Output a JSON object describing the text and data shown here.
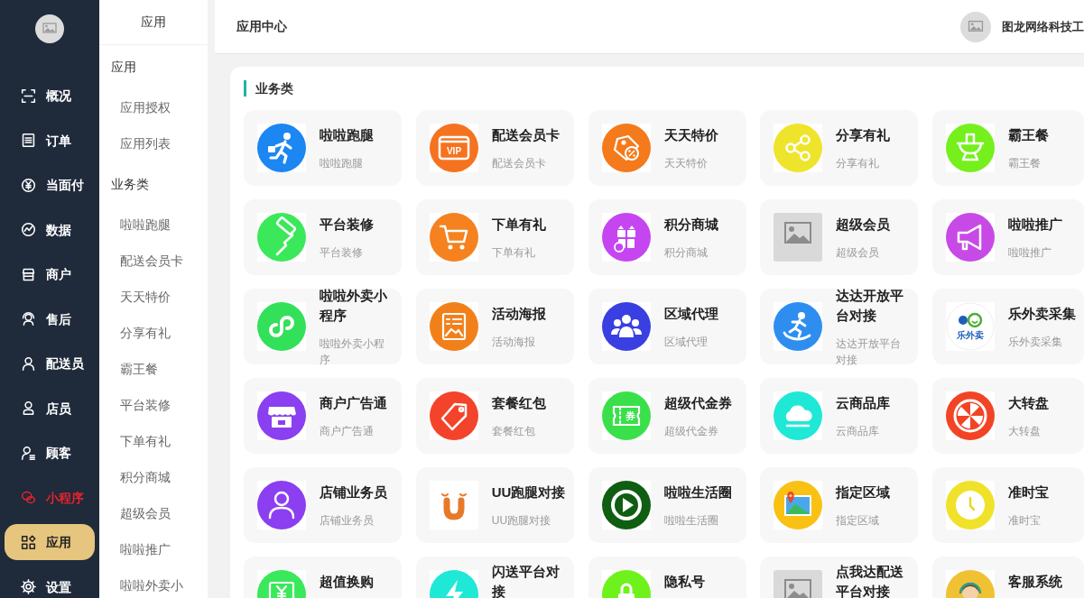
{
  "sidebar": {
    "items": [
      {
        "label": "概况",
        "selected": false,
        "highlighted": false
      },
      {
        "label": "订单",
        "selected": false,
        "highlighted": false
      },
      {
        "label": "当面付",
        "selected": false,
        "highlighted": false
      },
      {
        "label": "数据",
        "selected": false,
        "highlighted": false
      },
      {
        "label": "商户",
        "selected": false,
        "highlighted": false
      },
      {
        "label": "售后",
        "selected": false,
        "highlighted": false
      },
      {
        "label": "配送员",
        "selected": false,
        "highlighted": false
      },
      {
        "label": "店员",
        "selected": false,
        "highlighted": false
      },
      {
        "label": "顾客",
        "selected": false,
        "highlighted": false
      },
      {
        "label": "小程序",
        "selected": false,
        "highlighted": true
      },
      {
        "label": "应用",
        "selected": true,
        "highlighted": false
      },
      {
        "label": "设置",
        "selected": false,
        "highlighted": false
      }
    ]
  },
  "submenu": {
    "title": "应用",
    "groups": [
      {
        "heading": "应用",
        "items": [
          {
            "label": "应用授权",
            "selected": false
          },
          {
            "label": "应用列表",
            "selected": false
          }
        ]
      },
      {
        "heading": "业务类",
        "items": [
          {
            "label": "啦啦跑腿",
            "selected": false
          },
          {
            "label": "配送会员卡",
            "selected": false
          },
          {
            "label": "天天特价",
            "selected": false
          },
          {
            "label": "分享有礼",
            "selected": false
          },
          {
            "label": "霸王餐",
            "selected": false
          },
          {
            "label": "平台装修",
            "selected": false
          },
          {
            "label": "下单有礼",
            "selected": false
          },
          {
            "label": "积分商城",
            "selected": false
          },
          {
            "label": "超级会员",
            "selected": false
          },
          {
            "label": "啦啦推广",
            "selected": false
          },
          {
            "label": "啦啦外卖小",
            "selected": false
          }
        ]
      }
    ]
  },
  "header": {
    "title": "应用中心",
    "user": "图龙网络科技工"
  },
  "section": {
    "heading": "业务类",
    "apps": [
      {
        "title": "啦啦跑腿",
        "subtitle": "啦啦跑腿"
      },
      {
        "title": "配送会员卡",
        "subtitle": "配送会员卡",
        "icon_text": "VIP"
      },
      {
        "title": "天天特价",
        "subtitle": "天天特价"
      },
      {
        "title": "分享有礼",
        "subtitle": "分享有礼"
      },
      {
        "title": "霸王餐",
        "subtitle": "霸王餐"
      },
      {
        "title": "平台装修",
        "subtitle": "平台装修"
      },
      {
        "title": "下单有礼",
        "subtitle": "下单有礼"
      },
      {
        "title": "积分商城",
        "subtitle": "积分商城"
      },
      {
        "title": "超级会员",
        "subtitle": "超级会员"
      },
      {
        "title": "啦啦推广",
        "subtitle": "啦啦推广"
      },
      {
        "title": "啦啦外卖小程序",
        "subtitle": "啦啦外卖小程序"
      },
      {
        "title": "活动海报",
        "subtitle": "活动海报"
      },
      {
        "title": "区域代理",
        "subtitle": "区域代理"
      },
      {
        "title": "达达开放平台对接",
        "subtitle": "达达开放平台对接"
      },
      {
        "title": "乐外卖采集",
        "subtitle": "乐外卖采集",
        "icon_text": "乐外卖"
      },
      {
        "title": "商户广告通",
        "subtitle": "商户广告通"
      },
      {
        "title": "套餐红包",
        "subtitle": "套餐红包"
      },
      {
        "title": "超级代金券",
        "subtitle": "超级代金券",
        "icon_text": "券"
      },
      {
        "title": "云商品库",
        "subtitle": "云商品库"
      },
      {
        "title": "大转盘",
        "subtitle": "大转盘"
      },
      {
        "title": "店铺业务员",
        "subtitle": "店铺业务员"
      },
      {
        "title": "UU跑腿对接",
        "subtitle": "UU跑腿对接"
      },
      {
        "title": "啦啦生活圈",
        "subtitle": "啦啦生活圈"
      },
      {
        "title": "指定区域",
        "subtitle": "指定区域"
      },
      {
        "title": "准时宝",
        "subtitle": "准时宝"
      },
      {
        "title": "超值换购"
      },
      {
        "title": "闪送平台对接"
      },
      {
        "title": "隐私号"
      },
      {
        "title": "点我达配送平台对接"
      },
      {
        "title": "客服系统"
      }
    ]
  }
}
